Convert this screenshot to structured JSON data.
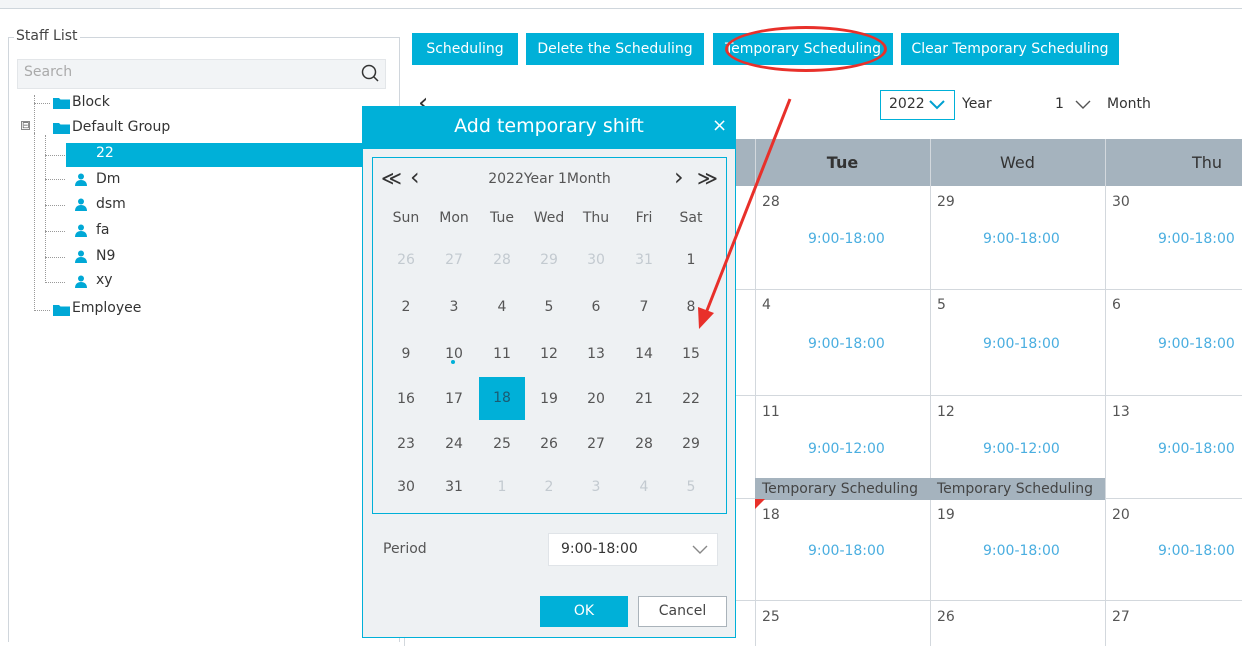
{
  "staff_list": {
    "title": "Staff List",
    "search_placeholder": "Search",
    "tree": {
      "block": "Block",
      "default_group": "Default Group",
      "selected": "22",
      "members": [
        "Dm",
        "dsm",
        "fa",
        "N9",
        "xy"
      ],
      "employee": "Employee",
      "expander": "⊟"
    }
  },
  "toolbar": {
    "scheduling": "Scheduling",
    "delete_scheduling": "Delete the Scheduling",
    "temporary_scheduling": "Temporary Scheduling",
    "clear_temporary_scheduling": "Clear Temporary Scheduling"
  },
  "nav": {
    "back": "‹",
    "year_value": "2022",
    "year_label": "Year",
    "month_value": "1",
    "month_label": "Month"
  },
  "calendar": {
    "headers": [
      "Tue",
      "Wed",
      "Thu"
    ],
    "rows": [
      {
        "days": [
          "28",
          "29",
          "30"
        ],
        "shifts": [
          "9:00-18:00",
          "9:00-18:00",
          "9:00-18:00"
        ]
      },
      {
        "days": [
          "4",
          "5",
          "6"
        ],
        "shifts": [
          "9:00-18:00",
          "9:00-18:00",
          "9:00-18:00"
        ]
      },
      {
        "days": [
          "11",
          "12",
          "13"
        ],
        "shifts": [
          "9:00-12:00",
          "9:00-12:00",
          "9:00-18:00"
        ],
        "temp": [
          "Temporary Scheduling",
          "Temporary Scheduling"
        ]
      },
      {
        "days": [
          "18",
          "19",
          "20"
        ],
        "shifts": [
          "9:00-18:00",
          "9:00-18:00",
          "9:00-18:00"
        ]
      },
      {
        "days": [
          "25",
          "26",
          "27"
        ]
      }
    ]
  },
  "modal": {
    "title": "Add temporary shift",
    "close": "×",
    "picker": {
      "heading": "2022Year 1Month",
      "prev_year": "≪",
      "prev_month": "‹",
      "next_month": "›",
      "next_year": "≫",
      "weekdays": [
        "Sun",
        "Mon",
        "Tue",
        "Wed",
        "Thu",
        "Fri",
        "Sat"
      ],
      "weeks": [
        [
          "26",
          "27",
          "28",
          "29",
          "30",
          "31",
          "1"
        ],
        [
          "2",
          "3",
          "4",
          "5",
          "6",
          "7",
          "8"
        ],
        [
          "9",
          "10",
          "11",
          "12",
          "13",
          "14",
          "15"
        ],
        [
          "16",
          "17",
          "18",
          "19",
          "20",
          "21",
          "22"
        ],
        [
          "23",
          "24",
          "25",
          "26",
          "27",
          "28",
          "29"
        ],
        [
          "30",
          "31",
          "1",
          "2",
          "3",
          "4",
          "5"
        ]
      ],
      "selected_day": "18"
    },
    "period_label": "Period",
    "period_value": "9:00-18:00",
    "ok": "OK",
    "cancel": "Cancel"
  },
  "colors": {
    "accent": "#00b0d8",
    "header_gray": "#a5b3be",
    "shift_blue": "#4aaee0",
    "annotation_red": "#e8302a"
  }
}
